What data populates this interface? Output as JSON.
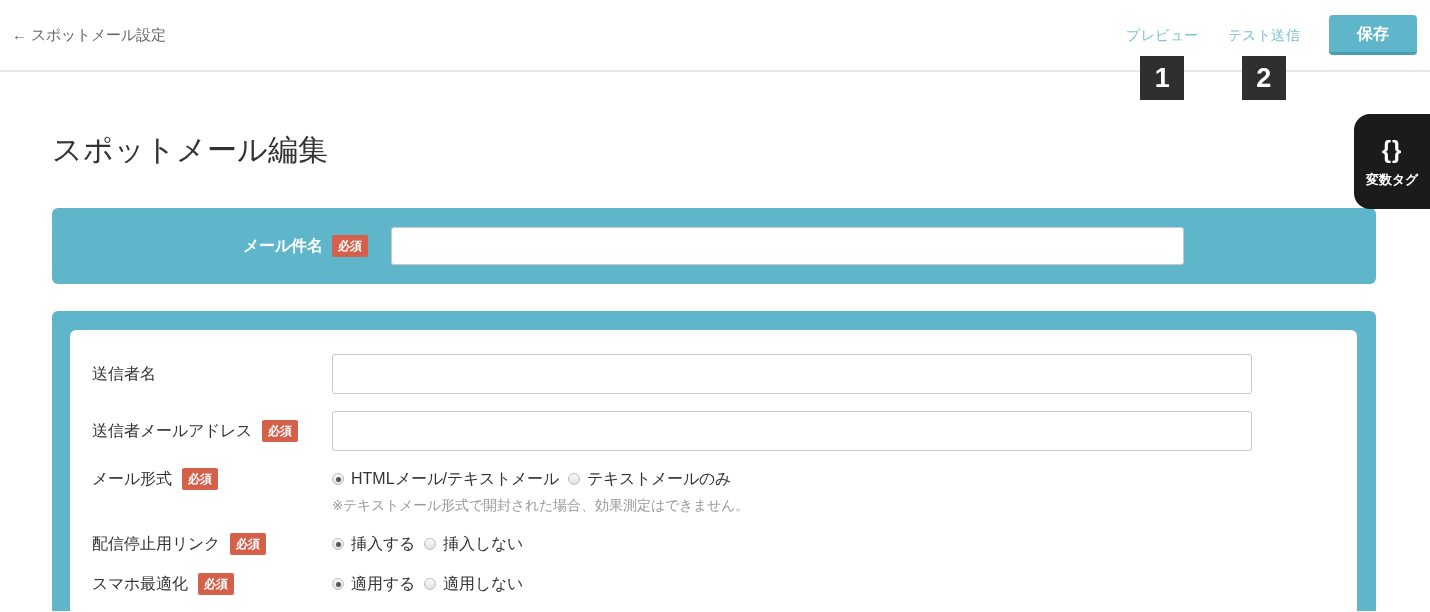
{
  "header": {
    "back_link": "← スポットメール設定",
    "links": [
      {
        "label": "プレビュー",
        "marker": "1"
      },
      {
        "label": "テスト送信",
        "marker": "2"
      }
    ],
    "save_button": "保存"
  },
  "variable_tag_tab": {
    "icon_text": "{}",
    "label": "変数タグ"
  },
  "page_title": "スポットメール編集",
  "subject": {
    "label": "メール件名",
    "required_badge": "必須"
  },
  "fields": [
    {
      "kind": "text",
      "label": "送信者名"
    },
    {
      "kind": "text",
      "label": "送信者メールアドレス",
      "required_badge": "必須"
    },
    {
      "kind": "radio",
      "label": "メール形式",
      "required_badge": "必須",
      "options": [
        {
          "label": "HTMLメール/テキストメール",
          "selected": true
        },
        {
          "label": "テキストメールのみ",
          "selected": false
        }
      ],
      "note": "※テキストメール形式で開封された場合、効果測定はできません。"
    },
    {
      "kind": "radio",
      "label": "配信停止用リンク",
      "required_badge": "必須",
      "options": [
        {
          "label": "挿入する",
          "selected": true
        },
        {
          "label": "挿入しない",
          "selected": false
        }
      ]
    },
    {
      "kind": "radio",
      "label": "スマホ最適化",
      "required_badge": "必須",
      "options": [
        {
          "label": "適用する",
          "selected": true
        },
        {
          "label": "適用しない",
          "selected": false
        }
      ]
    }
  ]
}
